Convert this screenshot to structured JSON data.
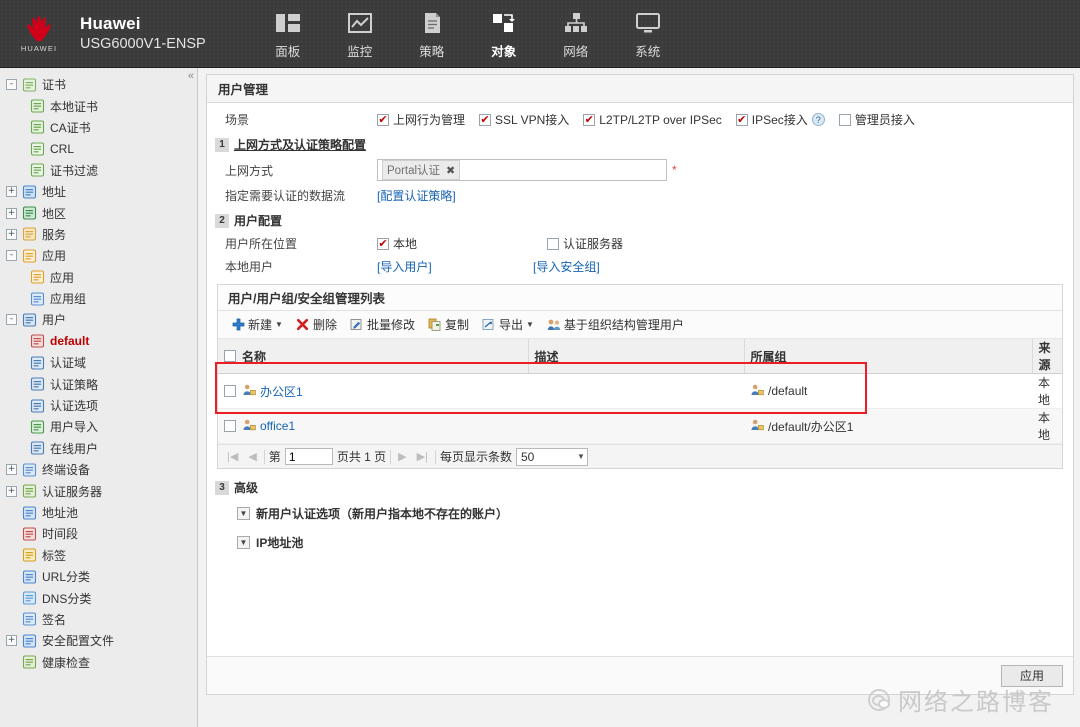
{
  "topbar": {
    "logo_word": "HUAWEI",
    "brand_line1": "Huawei",
    "brand_line2": "USG6000V1-ENSP",
    "nav": [
      {
        "label": "面板",
        "icon": "panel-icon"
      },
      {
        "label": "监控",
        "icon": "monitor-icon"
      },
      {
        "label": "策略",
        "icon": "policy-icon"
      },
      {
        "label": "对象",
        "icon": "object-icon"
      },
      {
        "label": "网络",
        "icon": "network-icon"
      },
      {
        "label": "系统",
        "icon": "system-icon"
      }
    ],
    "active_nav": "对象"
  },
  "sidebar": {
    "collapse_label": "«",
    "items": [
      {
        "label": "证书",
        "level": 1,
        "expander": "-",
        "icon": "certificate-icon"
      },
      {
        "label": "本地证书",
        "level": 2,
        "icon": "local-certificate-icon"
      },
      {
        "label": "CA证书",
        "level": 2,
        "icon": "ca-certificate-icon"
      },
      {
        "label": "CRL",
        "level": 2,
        "icon": "crl-icon"
      },
      {
        "label": "证书过滤",
        "level": 2,
        "icon": "certificate-filter-icon"
      },
      {
        "label": "地址",
        "level": 1,
        "expander": "+",
        "icon": "address-icon"
      },
      {
        "label": "地区",
        "level": 1,
        "expander": "+",
        "icon": "region-icon"
      },
      {
        "label": "服务",
        "level": 1,
        "expander": "+",
        "icon": "service-icon"
      },
      {
        "label": "应用",
        "level": 1,
        "expander": "-",
        "icon": "application-icon"
      },
      {
        "label": "应用",
        "level": 2,
        "icon": "application-icon"
      },
      {
        "label": "应用组",
        "level": 2,
        "icon": "application-group-icon"
      },
      {
        "label": "用户",
        "level": 1,
        "expander": "-",
        "icon": "user-icon"
      },
      {
        "label": "default",
        "level": 2,
        "icon": "user-group-icon",
        "selected": true
      },
      {
        "label": "认证域",
        "level": 2,
        "icon": "auth-domain-icon"
      },
      {
        "label": "认证策略",
        "level": 2,
        "icon": "auth-policy-icon"
      },
      {
        "label": "认证选项",
        "level": 2,
        "icon": "auth-option-icon"
      },
      {
        "label": "用户导入",
        "level": 2,
        "icon": "user-import-icon"
      },
      {
        "label": "在线用户",
        "level": 2,
        "icon": "online-user-icon"
      },
      {
        "label": "终端设备",
        "level": 1,
        "expander": "+",
        "icon": "terminal-device-icon"
      },
      {
        "label": "认证服务器",
        "level": 1,
        "expander": "+",
        "icon": "auth-server-icon"
      },
      {
        "label": "地址池",
        "level": 1,
        "expander": "",
        "icon": "address-pool-icon"
      },
      {
        "label": "时间段",
        "level": 1,
        "expander": "",
        "icon": "time-range-icon"
      },
      {
        "label": "标签",
        "level": 1,
        "expander": "",
        "icon": "tag-icon"
      },
      {
        "label": "URL分类",
        "level": 1,
        "expander": "",
        "icon": "url-category-icon"
      },
      {
        "label": "DNS分类",
        "level": 1,
        "expander": "",
        "icon": "dns-category-icon"
      },
      {
        "label": "签名",
        "level": 1,
        "expander": "",
        "icon": "signature-icon"
      },
      {
        "label": "安全配置文件",
        "level": 1,
        "expander": "+",
        "icon": "security-profile-icon"
      },
      {
        "label": "健康检查",
        "level": 1,
        "expander": "",
        "icon": "health-check-icon"
      }
    ]
  },
  "panel": {
    "title": "用户管理",
    "scene": {
      "label": "场景",
      "options": [
        {
          "label": "上网行为管理",
          "checked": true,
          "help": false
        },
        {
          "label": "SSL VPN接入",
          "checked": true,
          "help": false
        },
        {
          "label": "L2TP/L2TP over IPSec",
          "checked": true,
          "help": false
        },
        {
          "label": "IPSec接入",
          "checked": true,
          "help": true
        },
        {
          "label": "管理员接入",
          "checked": false,
          "help": false
        }
      ]
    },
    "step1": {
      "num": "1",
      "title": "上网方式及认证策略配置",
      "access_mode_label": "上网方式",
      "access_mode_tag": "Portal认证",
      "tag_remove": "✖",
      "required_mark": "*",
      "dataflow_label": "指定需要认证的数据流",
      "dataflow_link": "[配置认证策略]"
    },
    "step2": {
      "num": "2",
      "title": "用户配置",
      "location_label": "用户所在位置",
      "location_options": [
        {
          "label": "本地",
          "checked": true
        },
        {
          "label": "认证服务器",
          "checked": false
        }
      ],
      "local_user_label": "本地用户",
      "import_user_link": "[导入用户]",
      "import_group_link": "[导入安全组]"
    },
    "list": {
      "title": "用户/用户组/安全组管理列表",
      "toolbar": [
        {
          "label": "新建",
          "icon": "add-icon",
          "caret": true
        },
        {
          "label": "删除",
          "icon": "delete-icon",
          "caret": false
        },
        {
          "label": "批量修改",
          "icon": "batch-edit-icon",
          "caret": false
        },
        {
          "label": "复制",
          "icon": "copy-icon",
          "caret": false
        },
        {
          "label": "导出",
          "icon": "export-icon",
          "caret": true
        },
        {
          "label": "基于组织结构管理用户",
          "icon": "org-user-icon",
          "caret": false
        }
      ],
      "columns": [
        "名称",
        "描述",
        "所属组",
        "来源"
      ],
      "rows": [
        {
          "name": "办公区1",
          "desc": "",
          "group": "/default",
          "source": "本地",
          "checked": false
        },
        {
          "name": "office1",
          "desc": "",
          "group": "/default/办公区1",
          "source": "本地",
          "checked": false
        }
      ],
      "pager": {
        "first": "|◀",
        "prev": "◀",
        "next": "▶",
        "last": "▶|",
        "page_prefix": "第",
        "page_value": "1",
        "page_suffix": "页共 1 页",
        "size_label": "每页显示条数",
        "size_value": "50"
      }
    },
    "step3": {
      "num": "3",
      "title": "高级",
      "collapsibles": [
        {
          "label": "新用户认证选项（新用户指本地不存在的账户）"
        },
        {
          "label": "IP地址池"
        }
      ]
    },
    "apply_label": "应用"
  },
  "watermark": {
    "text": "网络之路博客",
    "icon": "wechat-icon"
  },
  "colors": {
    "accent_red": "#c00000",
    "highlight_red": "#ee1c25",
    "link_blue": "#1763b5",
    "topbar_bg": "#3b3b3b"
  }
}
